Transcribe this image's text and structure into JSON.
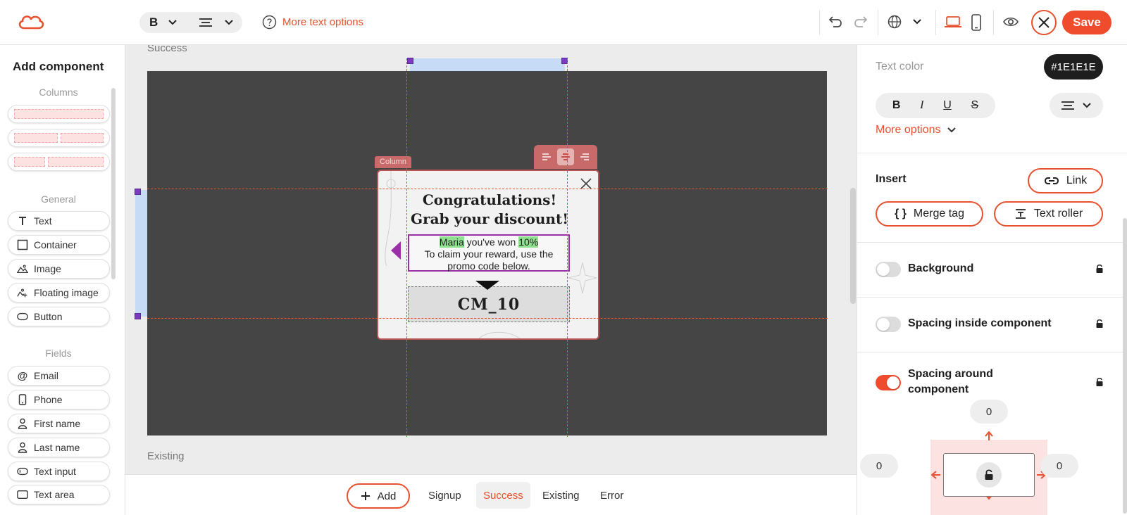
{
  "toolbar": {
    "bold_label": "B",
    "more_text_options": "More text options",
    "save_label": "Save"
  },
  "left_panel": {
    "title": "Add component",
    "columns_label": "Columns",
    "general_label": "General",
    "fields_label": "Fields",
    "general_items": [
      "Text",
      "Container",
      "Image",
      "Floating image",
      "Button"
    ],
    "field_items": [
      "Email",
      "Phone",
      "First name",
      "Last name",
      "Text input",
      "Text area"
    ]
  },
  "canvas": {
    "success_label": "Success",
    "existing_label": "Existing",
    "column_tag": "Column",
    "popup": {
      "title_line1": "Congratulations!",
      "title_line2": "Grab your discount!",
      "name_tag": "Maria",
      "won_text": " you've won ",
      "discount_tag": "10%",
      "claim_text": "To claim your reward, use the promo code below.",
      "promo_code": "CM_10"
    }
  },
  "bottom_tabs": {
    "add_label": "Add",
    "tabs": [
      "Signup",
      "Success",
      "Existing",
      "Error"
    ],
    "active": "Success"
  },
  "right_panel": {
    "text_color_label": "Text color",
    "text_color_value": "#1E1E1E",
    "style_b": "B",
    "style_i": "I",
    "style_u": "U",
    "style_s": "S",
    "more_options": "More options",
    "insert_label": "Insert",
    "link_label": "Link",
    "merge_tag_label": "Merge tag",
    "text_roller_label": "Text roller",
    "background_label": "Background",
    "background_on": false,
    "spacing_inside_label": "Spacing inside component",
    "spacing_inside_on": false,
    "spacing_around_label": "Spacing around component",
    "spacing_around_on": true,
    "spacing": {
      "top": "0",
      "left": "0",
      "right": "0"
    }
  },
  "colors": {
    "accent": "#E8502F",
    "save": "#EF4B2D",
    "stage": "#454545",
    "highlight": "#8FE08F",
    "selected_text_border": "#9B2FA8"
  }
}
